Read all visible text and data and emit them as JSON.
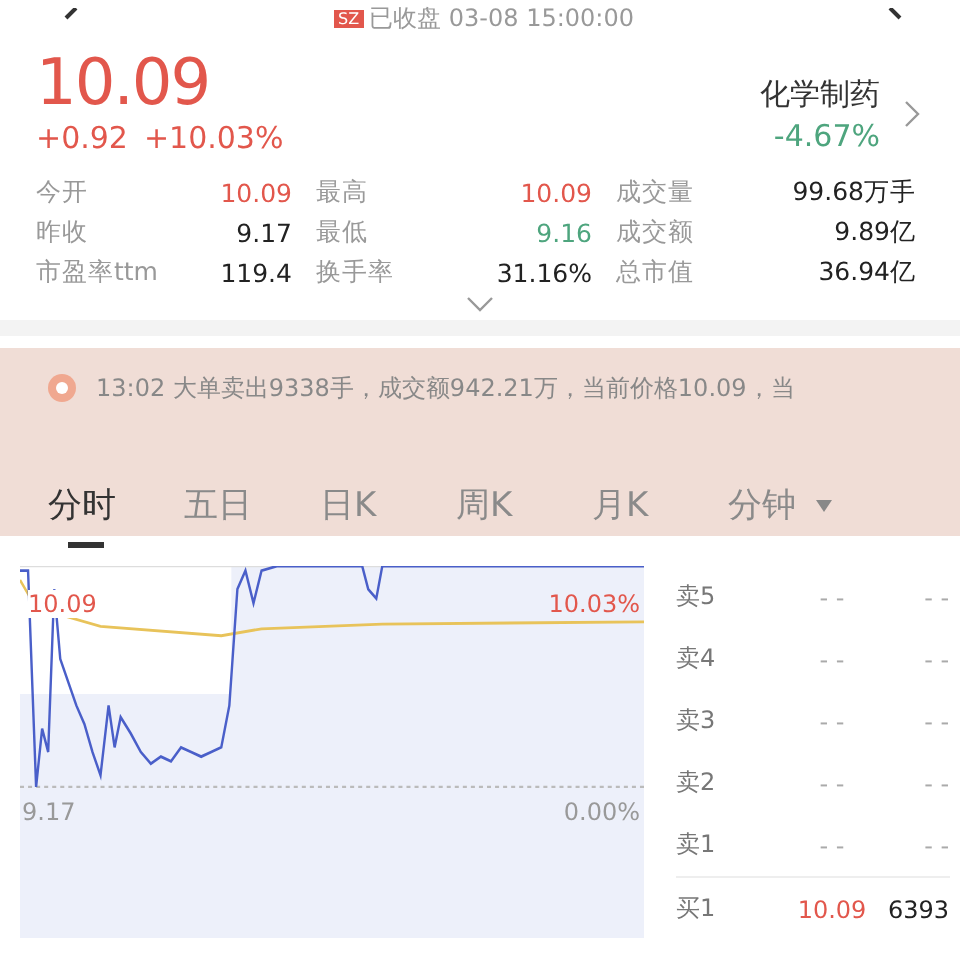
{
  "header": {
    "market": "SZ",
    "status": "已收盘 03-08 15:00:00"
  },
  "quote": {
    "price": "10.09",
    "change": "+0.92",
    "change_pct": "+10.03%",
    "sector": "化学制药",
    "sector_change": "-4.67%"
  },
  "stats": [
    {
      "label": "今开",
      "value": "10.09",
      "color": "#e2574c"
    },
    {
      "label": "最高",
      "value": "10.09",
      "color": "#e2574c"
    },
    {
      "label": "成交量",
      "value": "99.68万手",
      "color": "#222222"
    },
    {
      "label": "昨收",
      "value": "9.17",
      "color": "#222222"
    },
    {
      "label": "最低",
      "value": "9.16",
      "color": "#4ea57e"
    },
    {
      "label": "成交额",
      "value": "9.89亿",
      "color": "#222222"
    },
    {
      "label": "市盈率ttm",
      "value": "119.4",
      "color": "#222222"
    },
    {
      "label": "换手率",
      "value": "31.16%",
      "color": "#222222"
    },
    {
      "label": "总市值",
      "value": "36.94亿",
      "color": "#222222"
    }
  ],
  "news": {
    "text": "13:02 大单卖出9338手，成交额942.21万，当前价格10.09，当"
  },
  "tabs": [
    {
      "label": "分时",
      "selected": true
    },
    {
      "label": "五日",
      "selected": false
    },
    {
      "label": "日K",
      "selected": false
    },
    {
      "label": "周K",
      "selected": false
    },
    {
      "label": "月K",
      "selected": false
    },
    {
      "label": "分钟",
      "selected": false
    }
  ],
  "chart": {
    "high_price": "10.09",
    "high_pct": "10.03%",
    "base_price": "9.17",
    "base_pct": "0.00%"
  },
  "order_book": [
    {
      "label": "卖5",
      "price": "- -",
      "volume": "- -",
      "color": "#aaaaaa"
    },
    {
      "label": "卖4",
      "price": "- -",
      "volume": "- -",
      "color": "#aaaaaa"
    },
    {
      "label": "卖3",
      "price": "- -",
      "volume": "- -",
      "color": "#aaaaaa"
    },
    {
      "label": "卖2",
      "price": "- -",
      "volume": "- -",
      "color": "#aaaaaa"
    },
    {
      "label": "卖1",
      "price": "- -",
      "volume": "- -",
      "color": "#aaaaaa"
    },
    {
      "label": "买1",
      "price": "10.09",
      "volume": "6393",
      "color": "#e2574c"
    }
  ]
}
